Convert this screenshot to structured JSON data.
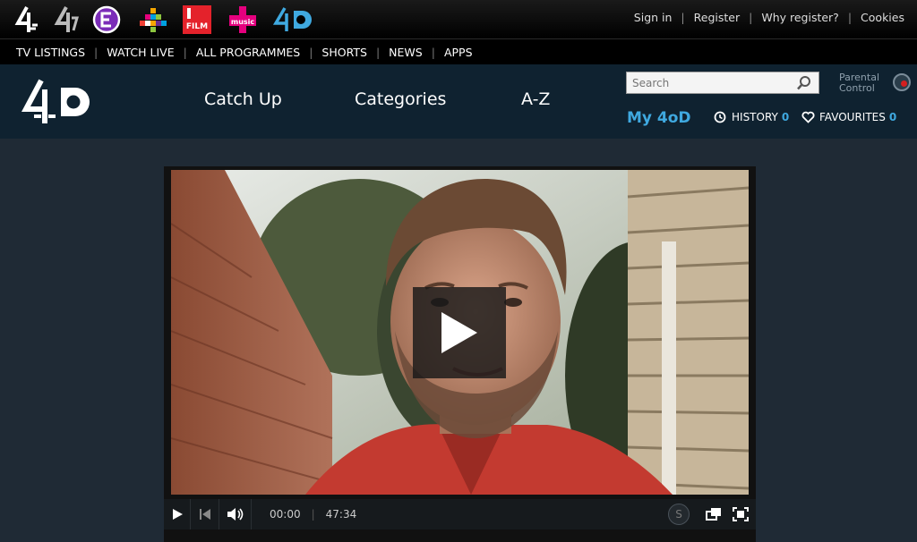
{
  "channels": [
    {
      "icon": "channel4-logo-icon"
    },
    {
      "icon": "channel4-plus1-logo-icon"
    },
    {
      "icon": "e4-logo-icon",
      "color": "#8a2be2"
    },
    {
      "icon": "more4-logo-icon"
    },
    {
      "icon": "film4-logo-icon",
      "text": "FILM",
      "color": "#e4222b"
    },
    {
      "icon": "4music-logo-icon",
      "text": "music",
      "color": "#e5007e"
    },
    {
      "icon": "4od-logo-icon",
      "color": "#3fa9e0"
    }
  ],
  "top_links": [
    "Sign in",
    "Register",
    "Why register?",
    "Cookies"
  ],
  "nav": [
    "TV LISTINGS",
    "WATCH LIVE",
    "ALL PROGRAMMES",
    "SHORTS",
    "NEWS",
    "APPS"
  ],
  "header": {
    "tabs": [
      "Catch Up",
      "Categories",
      "A-Z"
    ],
    "search_placeholder": "Search",
    "parental_label_1": "Parental",
    "parental_label_2": "Control",
    "my4od": "My 4oD",
    "history_label": "HISTORY",
    "history_count": "0",
    "favourites_label": "FAVOURITES",
    "favourites_count": "0"
  },
  "player": {
    "current_time": "00:00",
    "total_time": "47:34",
    "subtitles_label": "S"
  },
  "colors": {
    "accent": "#3fa9e0",
    "header_bg": "#0f2230",
    "page_bg": "#1f2a35"
  }
}
